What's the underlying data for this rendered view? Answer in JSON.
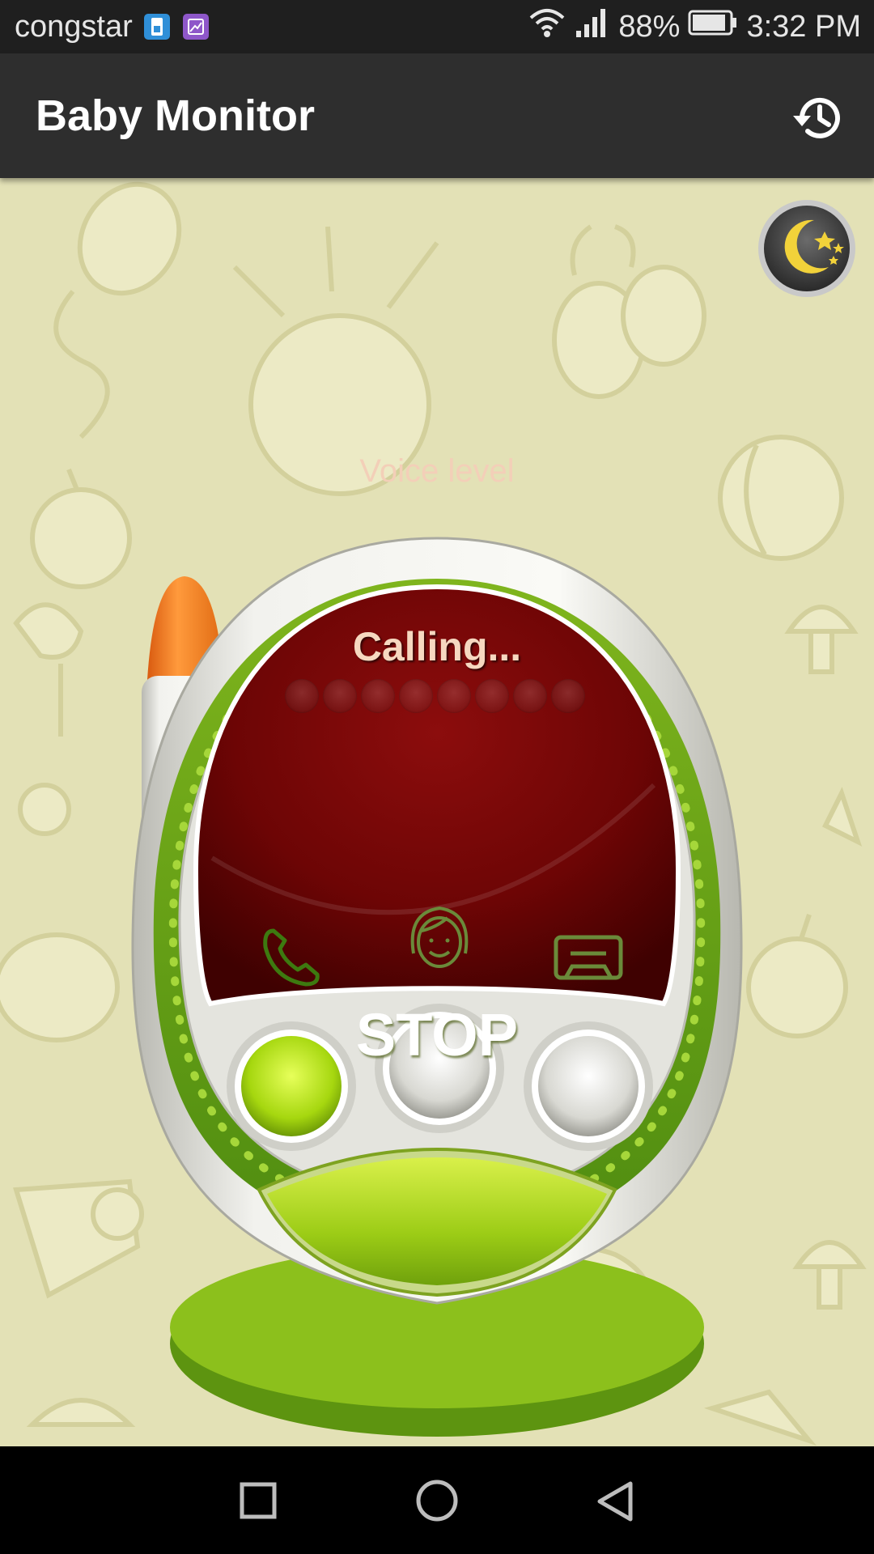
{
  "status_bar": {
    "carrier": "congstar",
    "battery": "88%",
    "time": "3:32 PM",
    "icons": [
      "sim-badge-icon",
      "gallery-badge-icon",
      "wifi-icon",
      "signal-icon",
      "battery-icon"
    ]
  },
  "app_bar": {
    "title": "Baby Monitor",
    "history_icon": "history-icon"
  },
  "monitor": {
    "night_mode_icon": "moon-stars-icon",
    "voice_level_label": "Voice level",
    "voice_level_dots": 8,
    "status_text": "Calling...",
    "buttons": [
      "phone-call-icon",
      "parent-face-icon",
      "cassette-icon"
    ],
    "stop_label": "STOP"
  },
  "nav_bar": {
    "icons": [
      "recents-square-icon",
      "home-circle-icon",
      "back-triangle-icon"
    ]
  },
  "colors": {
    "background": "#e3e1b6",
    "doodle": "#efedc9",
    "screen_red": "#7a0707",
    "accent_green": "#8dc21f",
    "antenna_orange": "#f07a1a"
  }
}
